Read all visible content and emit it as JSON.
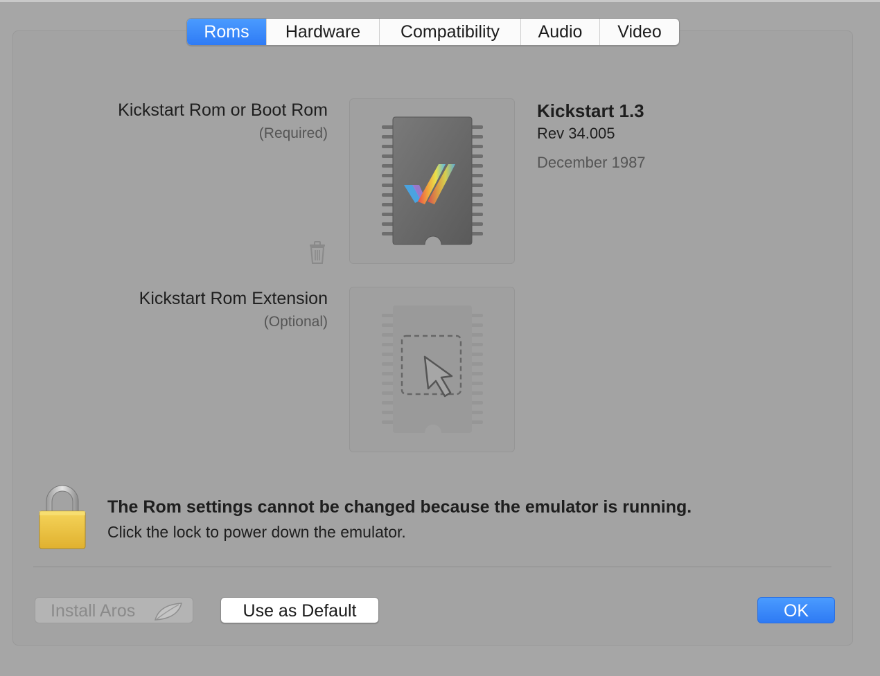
{
  "tabs": [
    {
      "label": "Roms",
      "active": true
    },
    {
      "label": "Hardware",
      "active": false
    },
    {
      "label": "Compatibility",
      "active": false
    },
    {
      "label": "Audio",
      "active": false
    },
    {
      "label": "Video",
      "active": false
    }
  ],
  "kickstart": {
    "label": "Kickstart Rom or Boot Rom",
    "sublabel": "(Required)",
    "rom_title": "Kickstart 1.3",
    "rom_rev": "Rev 34.005",
    "rom_date": "December 1987",
    "icon": "rom-chip-icon",
    "delete_icon": "trash-icon"
  },
  "extension": {
    "label": "Kickstart Rom Extension",
    "sublabel": "(Optional)",
    "icon": "drop-target-icon"
  },
  "lock_message": {
    "title": "The Rom settings cannot be changed because the emulator is running.",
    "detail": "Click the lock to power down the emulator.",
    "icon": "lock-icon"
  },
  "buttons": {
    "install": "Install Aros",
    "install_icon": "leaf-icon",
    "default": "Use as Default",
    "ok": "OK"
  },
  "colors": {
    "accent": "#2f7bf5",
    "lock": "#f2c744"
  }
}
